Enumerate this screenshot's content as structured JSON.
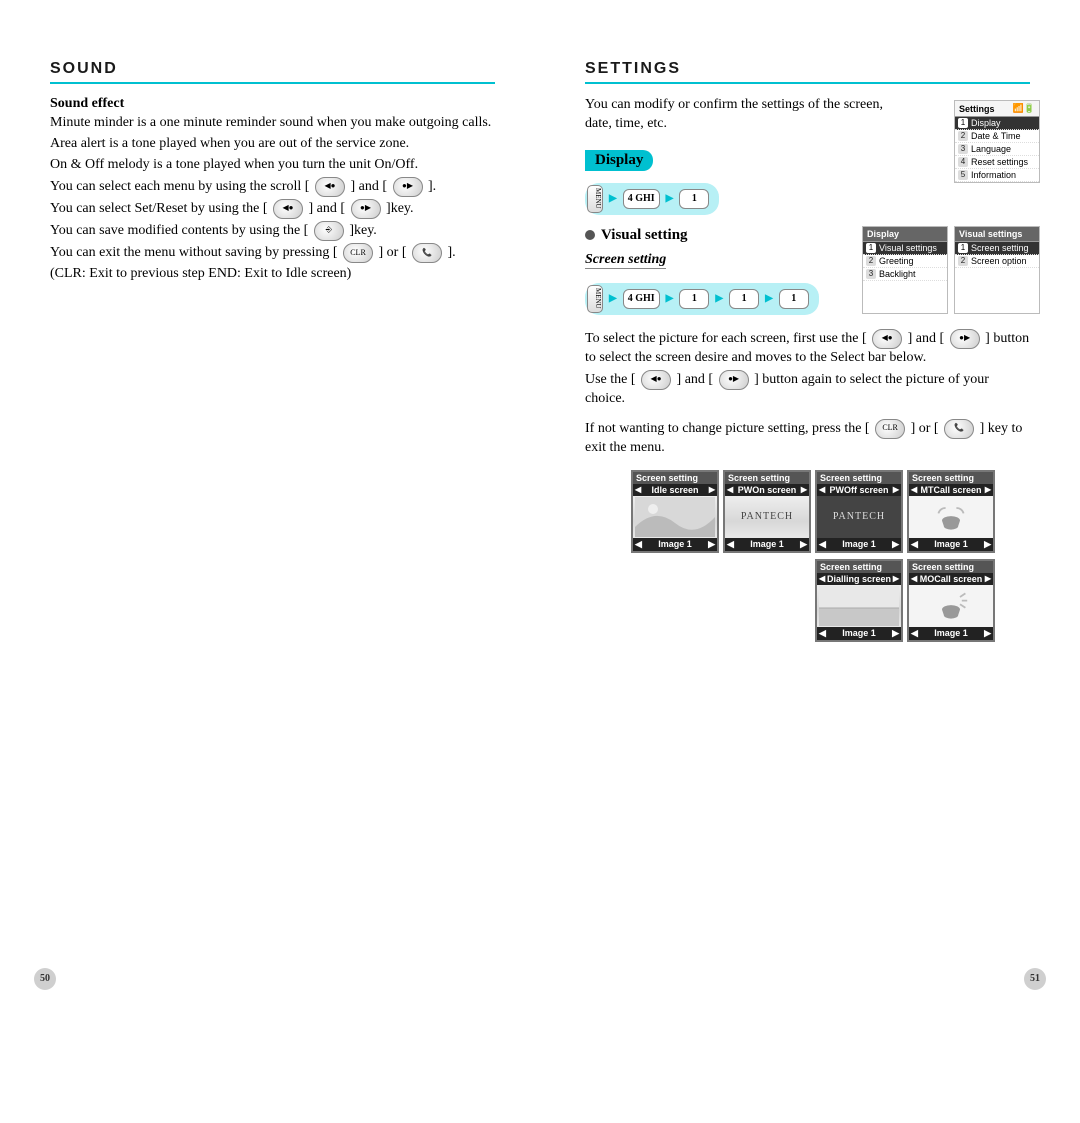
{
  "left": {
    "title": "SOUND",
    "subhead": "Sound effect",
    "p1": "Minute minder is a one minute reminder sound when you make outgoing calls.",
    "p2": "Area alert is a tone played when you are out of the service zone.",
    "p3": "On & Off melody is a tone played when you turn the unit On/Off.",
    "p4a": "You can select each menu by using the scroll [",
    "p4b": "] and [",
    "p4c": "].",
    "p5a": "You can select Set/Reset by using the [",
    "p5b": "] and [",
    "p5c": "]key.",
    "p6a": "You can save modified contents by using the [",
    "p6b": "]key.",
    "p7a": "You can exit the menu without saving by pressing [",
    "p7b": "] or [",
    "p7c": "].",
    "p8": "(CLR: Exit to previous step END: Exit to Idle screen)",
    "page_number": "50"
  },
  "right": {
    "title": "SETTINGS",
    "intro": "You can modify or confirm the settings of the screen, date, time, etc.",
    "display_tag": "Display",
    "visual_setting": "Visual setting",
    "screen_setting": "Screen setting",
    "nav1": {
      "menu": "MENU",
      "k1": "4 GHI",
      "k2": "1"
    },
    "nav2": {
      "menu": "MENU",
      "k1": "4 GHI",
      "k2": "1",
      "k3": "1",
      "k4": "1"
    },
    "q1a": "To select the picture for each screen, first use the [",
    "q1b": "] and [",
    "q1c": "] button to select the screen desire and moves to the Select bar below.",
    "q2a": "Use the [",
    "q2b": "] and [",
    "q2c": "] button again to select the picture of your choice.",
    "q3a": "If not wanting to change picture setting, press the [",
    "q3b": "] or [",
    "q3c": "] key to exit the menu.",
    "settings_menu": {
      "header": "Settings",
      "items": [
        "Display",
        "Date & Time",
        "Language",
        "Reset settings",
        "Information"
      ]
    },
    "display_menu": {
      "header": "Display",
      "items": [
        "Visual settings",
        "Greeting",
        "Backlight"
      ]
    },
    "visual_menu": {
      "header": "Visual settings",
      "items": [
        "Screen setting",
        "Screen option"
      ]
    },
    "screens": [
      {
        "title": "Screen setting",
        "sel": "Idle screen",
        "foot": "Image 1",
        "variant": "landscape"
      },
      {
        "title": "Screen setting",
        "sel": "PWOn screen",
        "foot": "Image 1",
        "variant": "pantech"
      },
      {
        "title": "Screen setting",
        "sel": "PWOff screen",
        "foot": "Image 1",
        "variant": "pantech-dark"
      },
      {
        "title": "Screen setting",
        "sel": "MTCall screen",
        "foot": "Image 1",
        "variant": "phone"
      },
      {
        "title": "Screen setting",
        "sel": "Dialling screen",
        "foot": "Image 1",
        "variant": "landscape2"
      },
      {
        "title": "Screen setting",
        "sel": "MOCall screen",
        "foot": "Image 1",
        "variant": "phone"
      }
    ],
    "page_number": "51",
    "clr_label": "CLR"
  }
}
